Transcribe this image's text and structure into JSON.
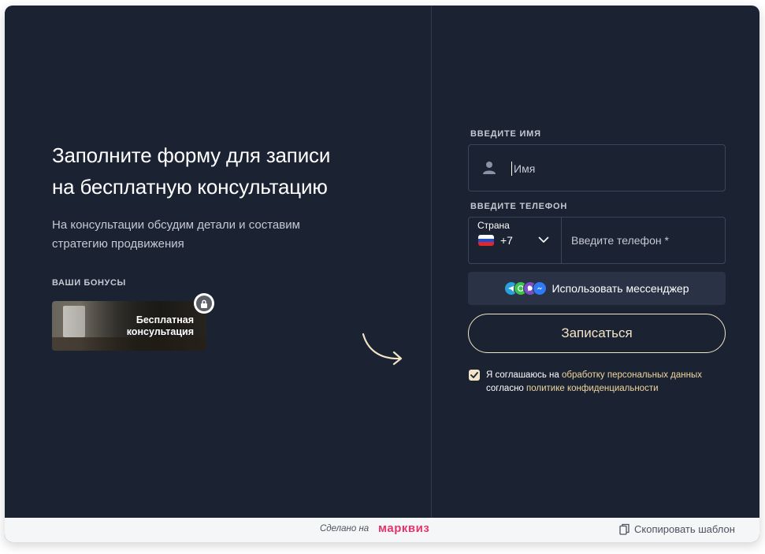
{
  "left": {
    "title_line1": "Заполните форму для записи",
    "title_line2": "на бесплатную консультацию",
    "subtitle_line1": "На консультации обсудим детали и составим",
    "subtitle_line2": "стратегию продвижения",
    "bonus_label": "ВАШИ БОНУСЫ",
    "bonus_title_line1": "Бесплатная",
    "bonus_title_line2": "консультация"
  },
  "form": {
    "name_label": "ВВЕДИТЕ ИМЯ",
    "name_placeholder": "Имя",
    "phone_label": "ВВЕДИТЕ ТЕЛЕФОН",
    "country_label": "Страна",
    "country_code": "+7",
    "phone_placeholder": "Введите телефон *",
    "messenger_label": "Использовать мессенджер",
    "submit_label": "Записаться",
    "consent_prefix": "Я соглашаюсь на",
    "consent_link1": "обработку персональных данных",
    "consent_middle": "согласно",
    "consent_link2": "политике конфиденциальности",
    "consent_checked": true
  },
  "footer": {
    "made_with": "Сделано на",
    "brand": "марквиз",
    "copy_template": "Скопировать шаблон"
  },
  "colors": {
    "background": "#1b2232",
    "accent": "#f2e4c6",
    "link": "#f0d79e",
    "brand": "#e6336b"
  },
  "icons": [
    "user-icon",
    "russia-flag-icon",
    "chevron-down-icon",
    "telegram-icon",
    "whatsapp-icon",
    "viber-icon",
    "messenger-icon",
    "lock-icon",
    "curved-arrow-icon",
    "check-icon",
    "copy-icon"
  ]
}
